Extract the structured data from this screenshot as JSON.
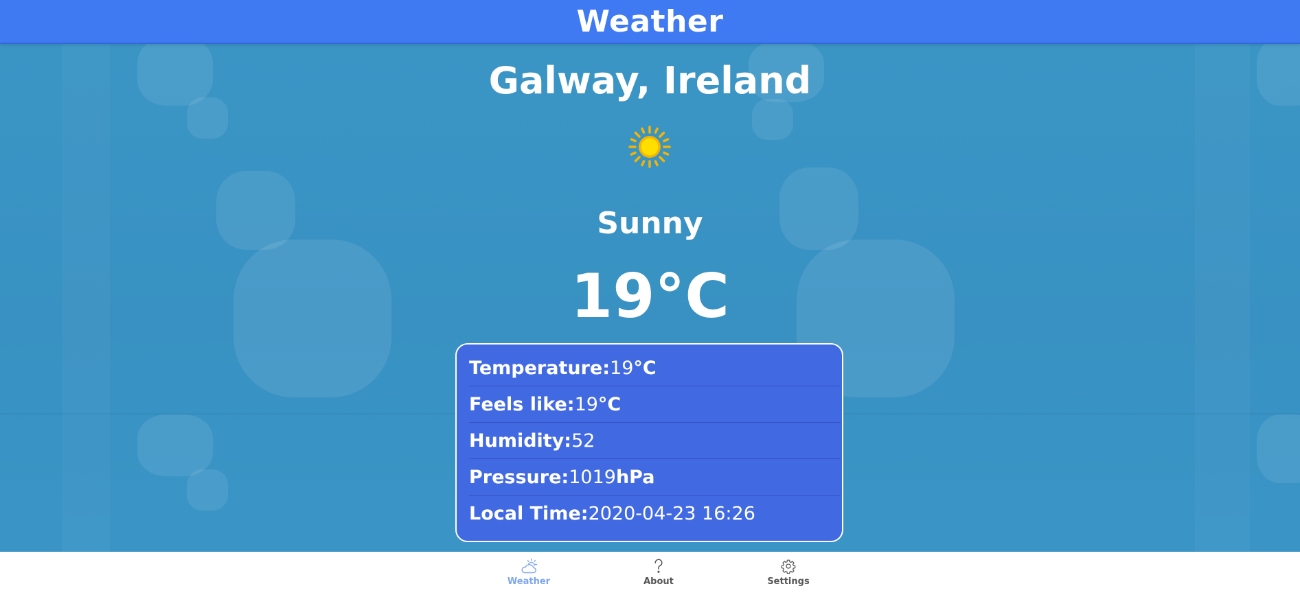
{
  "header": {
    "title": "Weather"
  },
  "weather": {
    "location": "Galway, Ireland",
    "icon": "sun-icon",
    "condition": "Sunny",
    "temperature": "19°C"
  },
  "details": [
    {
      "label": "Temperature:",
      "value": "19",
      "unit": "°C"
    },
    {
      "label": "Feels like:",
      "value": "19",
      "unit": "°C"
    },
    {
      "label": "Humidity:",
      "value": "52",
      "unit": ""
    },
    {
      "label": "Pressure:",
      "value": "1019",
      "unit": "hPa"
    },
    {
      "label": "Local Time:",
      "value": "2020-04-23 16:26",
      "unit": ""
    }
  ],
  "nav": {
    "items": [
      {
        "label": "Weather",
        "icon": "weather-cloud-sun-icon",
        "active": true
      },
      {
        "label": "About",
        "icon": "question-mark-icon",
        "active": false
      },
      {
        "label": "Settings",
        "icon": "gear-icon",
        "active": false
      }
    ]
  },
  "colors": {
    "header": "#3f7af3",
    "card": "#4169e1",
    "background": "#3a94c4",
    "nav_active": "#7ea6ee",
    "nav_inactive": "#555555",
    "sun_core": "#ffd400",
    "sun_rays": "#f5b400"
  }
}
